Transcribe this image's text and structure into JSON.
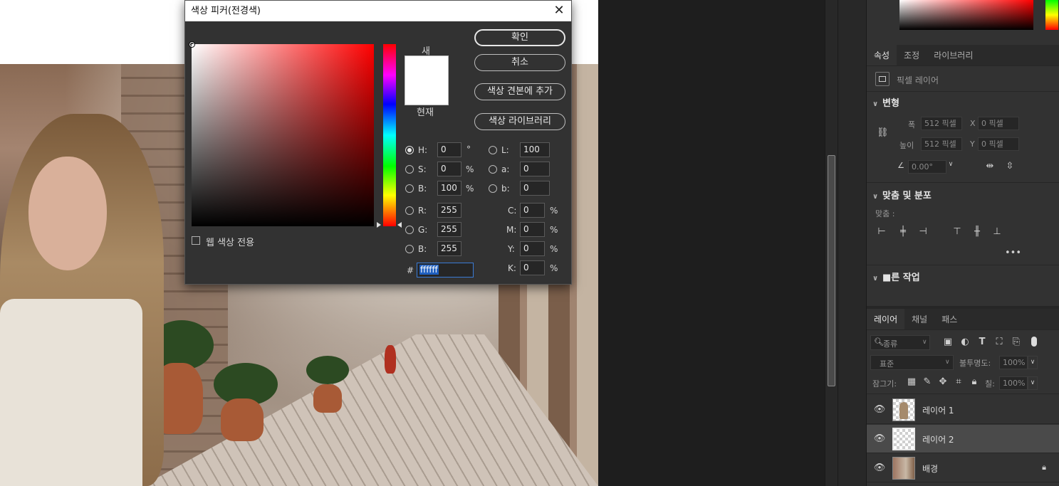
{
  "dialog": {
    "title": "색상 피커(전경색)",
    "new_label": "새",
    "current_label": "현재",
    "new_color": "#ffffff",
    "current_color": "#ffffff",
    "buttons": {
      "ok": "확인",
      "cancel": "취소",
      "add_to_swatches": "색상 견본에 추가",
      "color_libraries": "색상 라이브러리"
    },
    "web_colors_only": "웹 색상 전용",
    "hsb": [
      {
        "label": "H:",
        "value": "0",
        "unit": "°",
        "selected": true
      },
      {
        "label": "S:",
        "value": "0",
        "unit": "%",
        "selected": false
      },
      {
        "label": "B:",
        "value": "100",
        "unit": "%",
        "selected": false
      }
    ],
    "lab": [
      {
        "label": "L:",
        "value": "100"
      },
      {
        "label": "a:",
        "value": "0"
      },
      {
        "label": "b:",
        "value": "0"
      }
    ],
    "rgb": [
      {
        "label": "R:",
        "value": "255"
      },
      {
        "label": "G:",
        "value": "255"
      },
      {
        "label": "B:",
        "value": "255"
      }
    ],
    "cmyk": [
      {
        "label": "C:",
        "value": "0",
        "unit": "%"
      },
      {
        "label": "M:",
        "value": "0",
        "unit": "%"
      },
      {
        "label": "Y:",
        "value": "0",
        "unit": "%"
      },
      {
        "label": "K:",
        "value": "0",
        "unit": "%"
      }
    ],
    "hex_label": "#",
    "hex_value": "ffffff"
  },
  "properties_panel": {
    "tabs": [
      "속성",
      "조정",
      "라이브러리"
    ],
    "active_tab": "속성",
    "layer_type": "픽셀 레이어",
    "transform": {
      "title": "변형",
      "width_label": "폭",
      "width_value": "512 픽셀",
      "height_label": "높이",
      "height_value": "512 픽셀",
      "x_label": "X",
      "x_value": "0 픽셀",
      "y_label": "Y",
      "y_value": "0 픽셀",
      "angle_value": "0.00°"
    },
    "align": {
      "title": "맞춤 및 분포",
      "sub_label": "맞춤 :"
    },
    "quick_actions": {
      "title": "■른 작업"
    }
  },
  "layers_panel": {
    "tabs": [
      "레이어",
      "채널",
      "패스"
    ],
    "active_tab": "레이어",
    "filter_kind": "종류",
    "blend_mode": "표준",
    "opacity_label": "불투명도:",
    "opacity_value": "100%",
    "lock_label": "잠그기:",
    "fill_label": "칠:",
    "fill_value": "100%",
    "layers": [
      {
        "name": "레이어 1",
        "selected": false,
        "locked": false
      },
      {
        "name": "레이어 2",
        "selected": true,
        "locked": false
      },
      {
        "name": "배경",
        "selected": false,
        "locked": true
      }
    ]
  },
  "icons": {
    "close": "close-icon",
    "visibility": "eye-icon",
    "lock": "lock-icon",
    "link": "link-icon",
    "more": "more-icon"
  }
}
